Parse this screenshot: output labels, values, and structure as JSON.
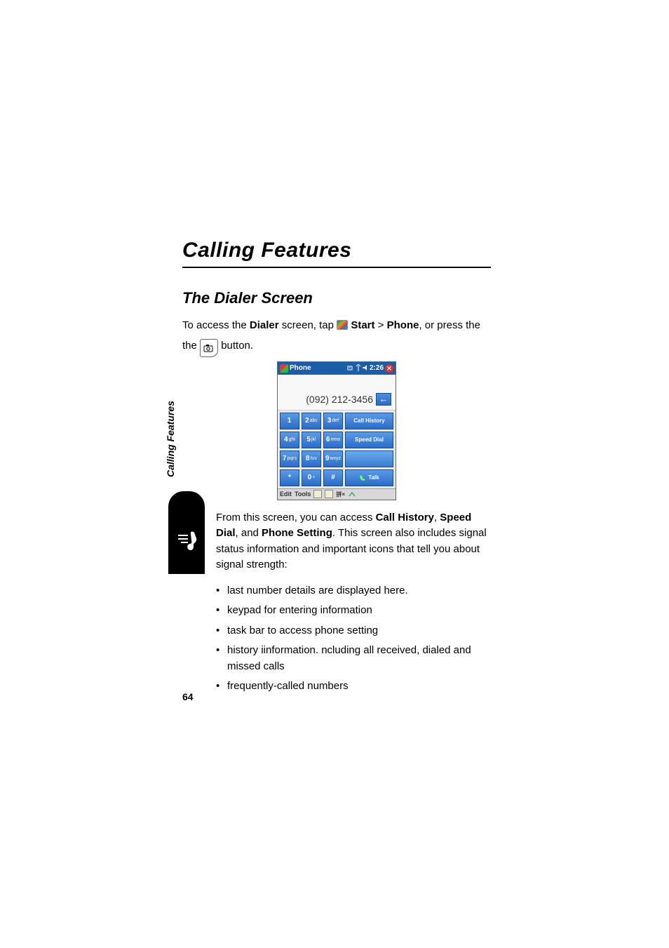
{
  "chapter_title": "Calling Features",
  "section_title": "The Dialer Screen",
  "intro": {
    "part1": "To access the ",
    "dialer_bold": "Dialer",
    "part2": " screen, tap ",
    "start_bold": "Start",
    "gt": " > ",
    "phone_bold": "Phone",
    "part3": ", or press the ",
    "part4": " button."
  },
  "side_label": "Calling Features",
  "phone_figure": {
    "title": "Phone",
    "status_time": "2:26",
    "display_number": "(092) 212-3456",
    "backspace_glyph": "←",
    "keys": [
      [
        {
          "n": "1",
          "s": ""
        },
        {
          "n": "2",
          "s": "abc"
        },
        {
          "n": "3",
          "s": "def"
        }
      ],
      [
        {
          "n": "4",
          "s": "ghi"
        },
        {
          "n": "5",
          "s": "jkl"
        },
        {
          "n": "6",
          "s": "mno"
        }
      ],
      [
        {
          "n": "7",
          "s": "pqrs"
        },
        {
          "n": "8",
          "s": "tuv"
        },
        {
          "n": "9",
          "s": "wxyz"
        }
      ],
      [
        {
          "n": "*",
          "s": ""
        },
        {
          "n": "0",
          "s": "+"
        },
        {
          "n": "#",
          "s": ""
        }
      ]
    ],
    "right_buttons": [
      "Call History",
      "Speed Dial",
      "",
      "Talk"
    ],
    "bottom": {
      "edit": "Edit",
      "tools": "Tools"
    }
  },
  "body_para": {
    "p1": "From this screen, you can access ",
    "b1": "Call History",
    "sep1": ", ",
    "b2": "Speed Dial",
    "sep2": ", and ",
    "b3": "Phone Setting",
    "p2": ". This screen also includes signal status information and important icons that tell you about signal strength:"
  },
  "bullets": [
    "last number details are displayed here.",
    "keypad for entering information",
    "task bar to access phone setting",
    "history iinformation. ncluding all received, dialed and missed calls",
    "frequently-called numbers"
  ],
  "page_number": "64"
}
